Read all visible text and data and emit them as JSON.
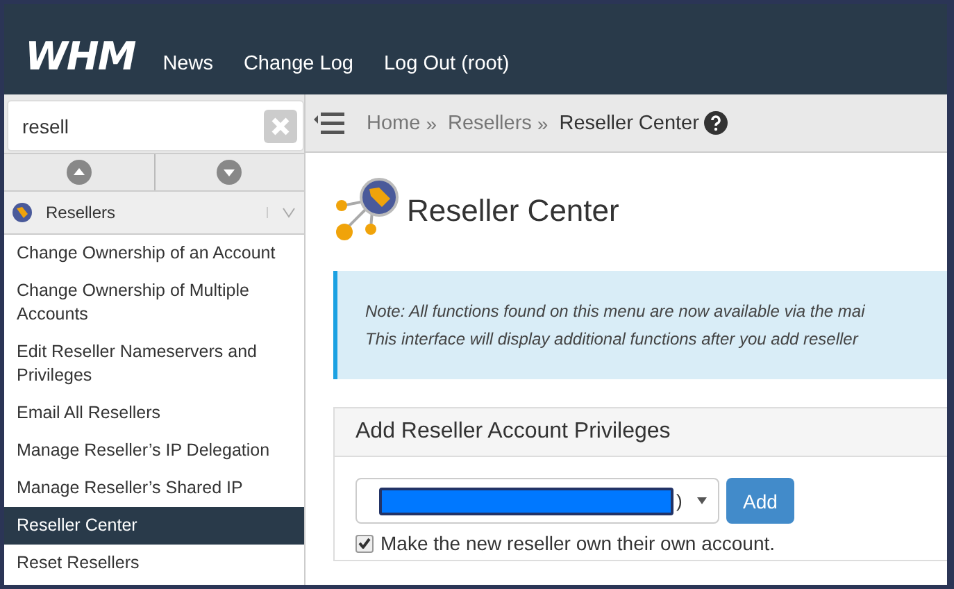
{
  "header": {
    "logo": "WHM",
    "nav": [
      "News",
      "Change Log",
      "Log Out (root)"
    ]
  },
  "sidebar": {
    "search": {
      "value": "resell"
    },
    "category": {
      "label": "Resellers",
      "expanded": true
    },
    "items": [
      {
        "label": "Change Ownership of an Account",
        "selected": false
      },
      {
        "label": "Change Ownership of Multiple Accounts",
        "selected": false
      },
      {
        "label": "Edit Reseller Nameservers and Privileges",
        "selected": false
      },
      {
        "label": "Email All Resellers",
        "selected": false
      },
      {
        "label": "Manage Reseller’s IP Delegation",
        "selected": false
      },
      {
        "label": "Manage Reseller’s Shared IP",
        "selected": false
      },
      {
        "label": "Reseller Center",
        "selected": true
      },
      {
        "label": "Reset Resellers",
        "selected": false
      }
    ]
  },
  "breadcrumb": {
    "items": [
      "Home",
      "Resellers",
      "Reseller Center"
    ],
    "separator": "»"
  },
  "page": {
    "title": "Reseller Center",
    "note": [
      "Note: All functions found on this menu are now available via the mai",
      "This interface will display additional functions after you add reseller"
    ],
    "panel": {
      "title": "Add Reseller Account Privileges",
      "select": {
        "value": ")"
      },
      "button": "Add",
      "checkbox": {
        "label": "Make the new reseller own their own account.",
        "checked": true
      }
    }
  }
}
